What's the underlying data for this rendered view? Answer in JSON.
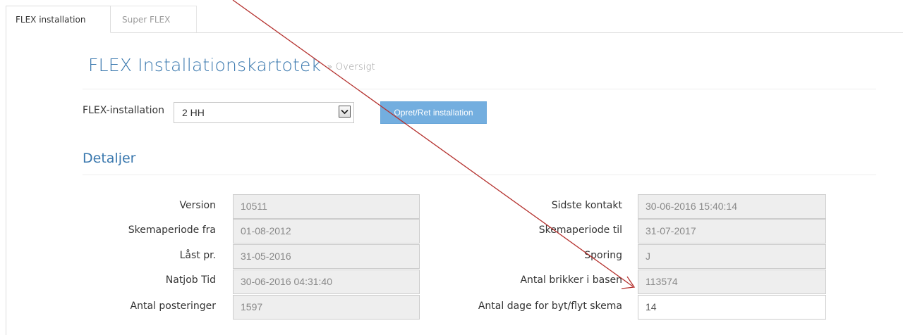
{
  "tabs": [
    {
      "label": "FLEX installation",
      "active": true
    },
    {
      "label": "Super FLEX",
      "active": false
    }
  ],
  "page": {
    "title": "FLEX Installationskartotek",
    "subtitle": "» Oversigt"
  },
  "installation": {
    "label": "FLEX-installation",
    "selected": "2 HH",
    "button_label": "Opret/Ret installation"
  },
  "details": {
    "heading": "Detaljer",
    "left": [
      {
        "label": "Version",
        "value": "10511"
      },
      {
        "label": "Skemaperiode fra",
        "value": "01-08-2012"
      },
      {
        "label": "Låst pr.",
        "value": "31-05-2016"
      },
      {
        "label": "Natjob Tid",
        "value": "30-06-2016 04:31:40"
      },
      {
        "label": "Antal posteringer",
        "value": "1597"
      }
    ],
    "right": [
      {
        "label": "Sidste kontakt",
        "value": "30-06-2016 15:40:14"
      },
      {
        "label": "Skemaperiode til",
        "value": "31-07-2017"
      },
      {
        "label": "Sporing",
        "value": "J"
      },
      {
        "label": "Antal brikker i basen",
        "value": "113574"
      },
      {
        "label": "Antal dage for byt/flyt skema",
        "value": "14"
      }
    ]
  },
  "colors": {
    "accent": "#3a78ae",
    "button": "#73aedf",
    "annotation_arrow": "#b5322f"
  },
  "icons": {
    "select_arrow": "chevron-down-icon",
    "annotation": "arrow-annotation"
  }
}
